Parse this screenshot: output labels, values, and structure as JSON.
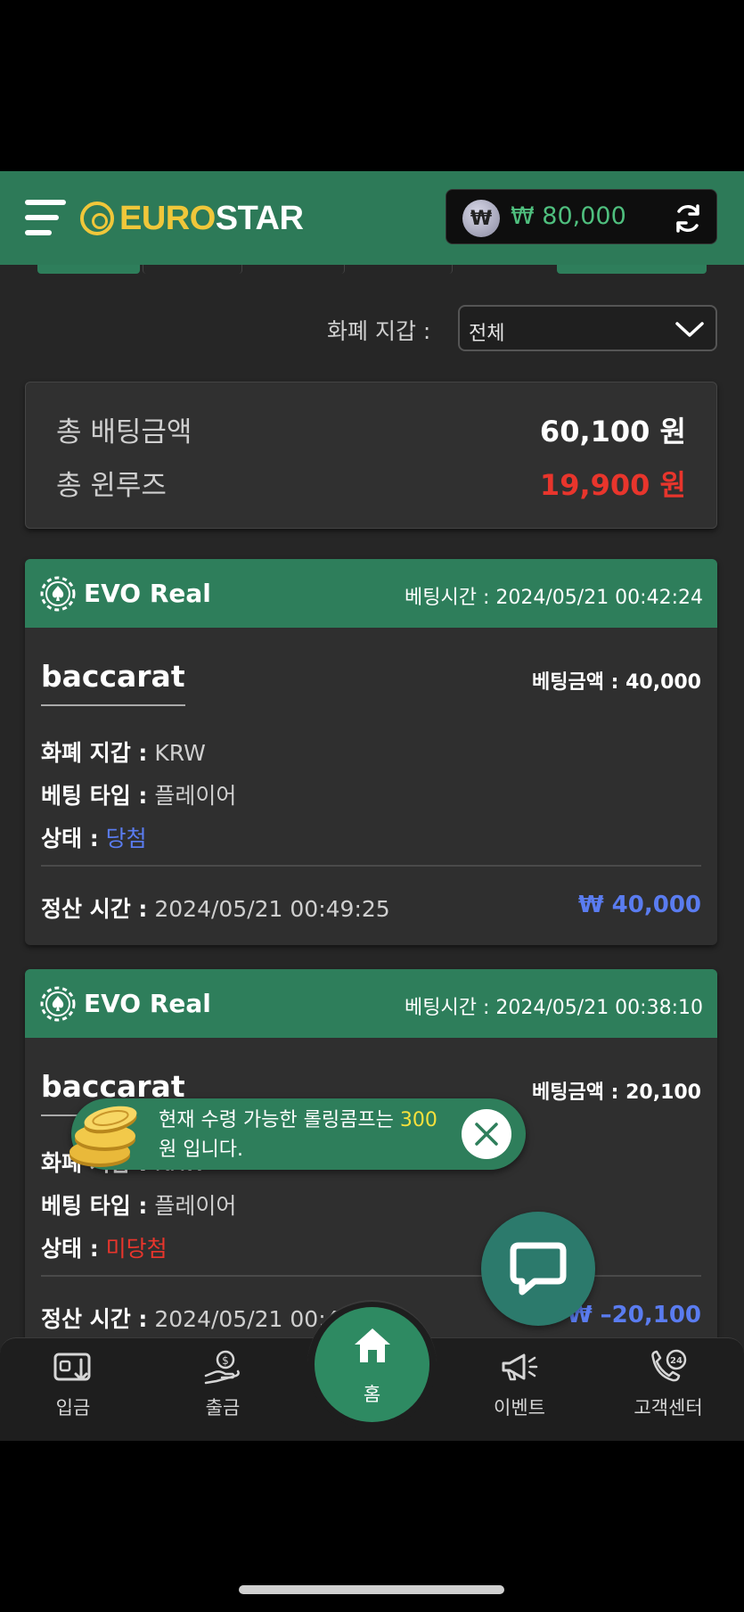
{
  "header": {
    "logo_euro": "EURO",
    "logo_star": "STAR",
    "currency_symbol": "₩",
    "balance": "₩ 80,000"
  },
  "filter": {
    "label": "화폐 지갑 :",
    "selected": "전체"
  },
  "summary": {
    "total_bet_label": "총 배팅금액",
    "total_bet_value": "60,100 원",
    "total_winloss_label": "총 윈루즈",
    "total_winloss_value": "19,900 원"
  },
  "bets": [
    {
      "provider": "EVO Real",
      "bet_time": "베팅시간 : 2024/05/21 00:42:24",
      "game": "baccarat",
      "bet_amount": "베팅금액 : 40,000",
      "wallet_label": "화폐 지갑 :",
      "wallet_value": "KRW",
      "type_label": "베팅 타입 :",
      "type_value": "플레이어",
      "status_label": "상태 :",
      "status_value": "당첨",
      "status_color": "#5a7cf0",
      "settle_label": "정산 시간 :",
      "settle_value": "2024/05/21 00:49:25",
      "payout": "₩ 40,000"
    },
    {
      "provider": "EVO Real",
      "bet_time": "베팅시간 : 2024/05/21 00:38:10",
      "game": "baccarat",
      "bet_amount": "베팅금액 : 20,100",
      "wallet_label": "화폐 지갑 :",
      "wallet_value": "KRW",
      "type_label": "베팅 타입 :",
      "type_value": "플레이어",
      "status_label": "상태 :",
      "status_value": "미당첨",
      "status_color": "#e8352c",
      "settle_label": "정산 시간 :",
      "settle_value": "2024/05/21 00:4",
      "payout": "₩ –20,100"
    }
  ],
  "toast": {
    "text_before": "현재 수령 가능한 롤링콤프는 ",
    "amount": "300",
    "text_after": " 원 입니다."
  },
  "nav": {
    "deposit": "입금",
    "withdraw": "출금",
    "home": "홈",
    "event": "이벤트",
    "support": "고객센터"
  },
  "colors": {
    "brand_green": "#2d7a58",
    "accent_yellow": "#f0c73a",
    "win_blue": "#5a7cf0",
    "loss_red": "#e8352c"
  }
}
